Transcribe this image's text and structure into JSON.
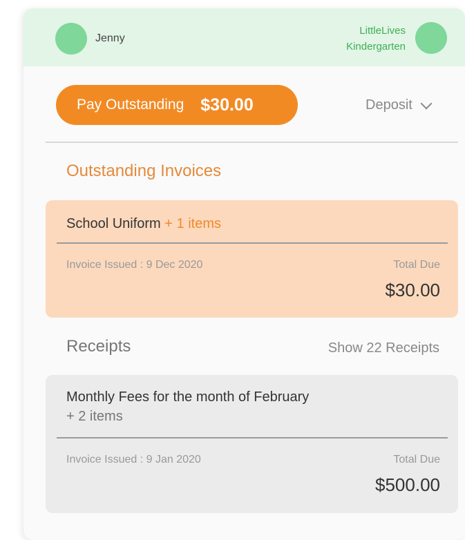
{
  "header": {
    "user_name": "Jenny",
    "school_name_line1": "LittleLives",
    "school_name_line2": "Kindergarten",
    "colors": {
      "background": "#e2f5e7",
      "avatar": "#7fd79a",
      "school_text": "#3fae54"
    }
  },
  "actions": {
    "pay_label": "Pay Outstanding",
    "pay_amount": "$30.00",
    "deposit_label": "Deposit",
    "deposit_icon": "chevron-down-icon",
    "colors": {
      "pay_button": "#f28a24"
    }
  },
  "outstanding": {
    "title": "Outstanding Invoices",
    "invoices": [
      {
        "title": "School Uniform",
        "extra_items": "+ 1 items",
        "issued": "Invoice Issued : 9 Dec 2020",
        "total_label": "Total Due",
        "total": "$30.00"
      }
    ],
    "colors": {
      "title": "#e5893a",
      "card": "#fcd9bd"
    }
  },
  "receipts": {
    "title": "Receipts",
    "show_all": "Show 22 Receipts",
    "items": [
      {
        "title": "Monthly Fees for the month of February",
        "extra_items": "+ 2 items",
        "issued": "Invoice Issued : 9 Jan 2020",
        "total_label": "Total Due",
        "total": "$500.00"
      }
    ],
    "colors": {
      "card": "#ebebeb"
    }
  }
}
